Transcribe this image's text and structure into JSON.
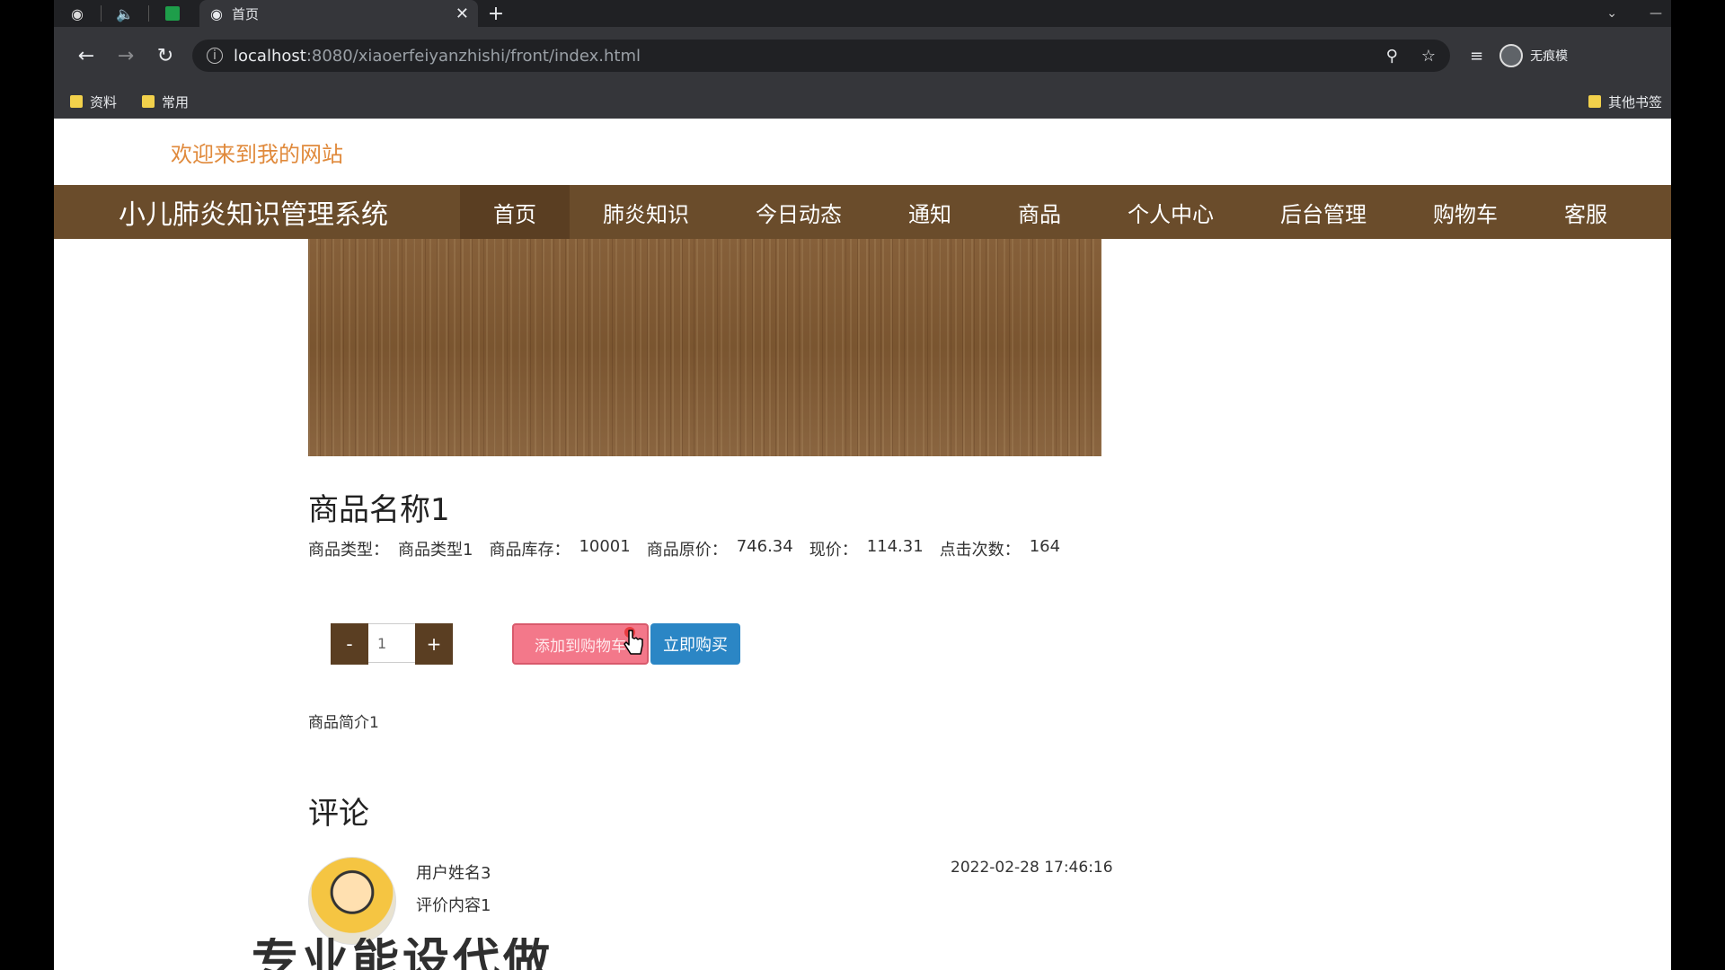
{
  "browser": {
    "tab_title": "首页",
    "url_host": "localhost",
    "url_path": ":8080/xiaoerfeiyanzhishi/front/index.html",
    "profile_name": "无痕模",
    "bookmarks": [
      "资料",
      "常用"
    ],
    "other_bookmarks": "其他书签"
  },
  "site": {
    "welcome": "欢迎来到我的网站",
    "brand": "小儿肺炎知识管理系统",
    "menu": [
      "首页",
      "肺炎知识",
      "今日动态",
      "通知",
      "商品",
      "个人中心",
      "后台管理",
      "购物车",
      "客服"
    ]
  },
  "product": {
    "name": "商品名称1",
    "type_label": "商品类型：",
    "type_value": "商品类型1",
    "stock_label": "商品库存：",
    "stock_value": "10001",
    "orig_price_label": "商品原价：",
    "orig_price_value": "746.34",
    "price_label": "现价：",
    "price_value": "114.31",
    "clicks_label": "点击次数：",
    "clicks_value": "164",
    "quantity": "1",
    "minus": "-",
    "plus": "+",
    "add_to_cart": "添加到购物车",
    "buy_now": "立即购买",
    "intro": "商品简介1"
  },
  "comments": {
    "heading": "评论",
    "items": [
      {
        "user": "用户姓名3",
        "content": "评价内容1",
        "time": "2022-02-28 17:46:16"
      }
    ]
  },
  "overlay_text": "专业能设代做"
}
